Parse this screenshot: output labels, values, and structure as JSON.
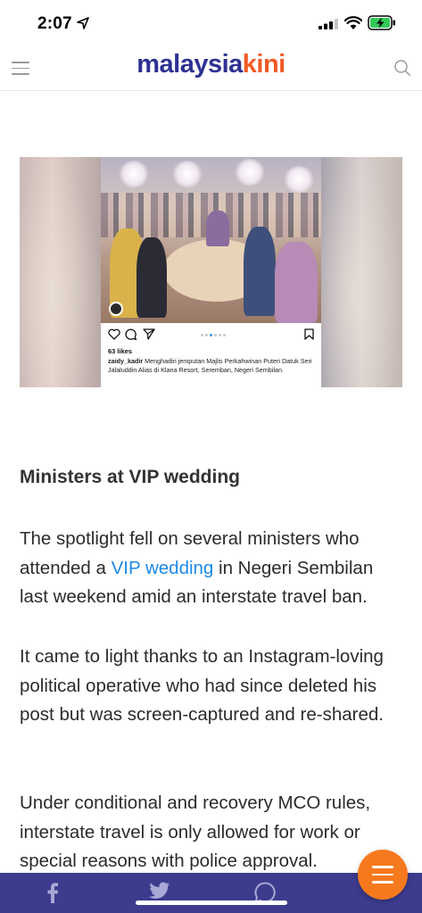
{
  "status_bar": {
    "time": "2:07"
  },
  "header": {
    "logo_part1": "malaysia",
    "logo_part2": "kini",
    "brand_colors": {
      "primary": "#2e3192",
      "accent": "#f15a24"
    }
  },
  "instagram_post": {
    "likes": "63 likes",
    "username": "zaidy_kadir",
    "caption": "Menghadiri jemputan Majlis Perkahwinan Puteri Datuk Seri Jalaluddin Alias di Klana Resort, Seremban, Negeri Sembilan."
  },
  "article": {
    "subheading": "Ministers at VIP wedding",
    "para1_before": "The spotlight fell on several ministers who attended a ",
    "para1_link": "VIP wedding",
    "para1_after": " in Negeri Sembilan last weekend amid an interstate travel ban.",
    "para2": "It came to light thanks to an Instagram-loving political operative who had since deleted his post but was screen-captured and re-shared.",
    "para3": "Under conditional and recovery MCO rules, interstate travel is only allowed for work or special reasons with police approval."
  },
  "share_bar": {
    "icons": [
      "facebook-icon",
      "twitter-icon",
      "whatsapp-icon"
    ],
    "background": "#3c3b8e"
  },
  "fab": {
    "icon": "menu-icon",
    "color": "#f7791e"
  }
}
